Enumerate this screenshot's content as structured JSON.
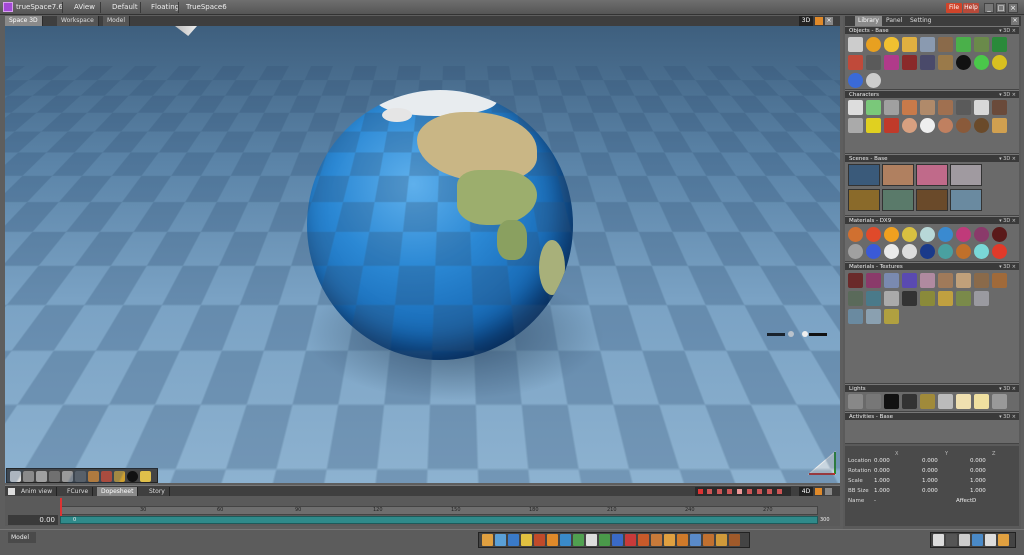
{
  "titlebar": {
    "app_title": "trueSpace7.6",
    "tabs": [
      "AView",
      "Default",
      "Floating",
      "TrueSpace6"
    ],
    "buttons": {
      "file": "File",
      "help": "Help"
    },
    "window_controls": [
      "_",
      "□",
      "×"
    ]
  },
  "viewport": {
    "tabs": [
      "Space 3D",
      "Workspace",
      "Model"
    ],
    "mode_badge": "3D"
  },
  "timeline": {
    "tabs": [
      "Anim view",
      "FCurve",
      "Dopesheet",
      "Story"
    ],
    "mode_badge": "4D",
    "current_time": "0.00",
    "start_frame": "0",
    "end_frame": "300",
    "ticks": [
      "30",
      "60",
      "90",
      "120",
      "150",
      "180",
      "210",
      "240",
      "270"
    ]
  },
  "statusbar": {
    "mode_label": "Model"
  },
  "right_panel": {
    "tabs": [
      "Library",
      "Panel",
      "Setting"
    ],
    "sections": [
      {
        "id": "objects",
        "title": "Objects - Base",
        "controls": "▾ 3D ×"
      },
      {
        "id": "characters",
        "title": "Characters",
        "controls": "▾ 3D ×"
      },
      {
        "id": "scenes",
        "title": "Scenes - Base",
        "controls": "▾ 3D ×"
      },
      {
        "id": "materials-dx9",
        "title": "Materials - DX9",
        "controls": "▾ 3D ×"
      },
      {
        "id": "materials-textures",
        "title": "Materials - Textures",
        "controls": "▾ 3D ×"
      },
      {
        "id": "lights",
        "title": "Lights",
        "controls": "▾ 3D ×"
      },
      {
        "id": "activities",
        "title": "Activities - Base",
        "controls": "▾ 3D ×"
      }
    ]
  },
  "properties": {
    "columns": [
      "X",
      "Y",
      "Z"
    ],
    "rows": [
      {
        "label": "Location",
        "values": [
          "0.000",
          "0.000",
          "0.000"
        ]
      },
      {
        "label": "Rotation",
        "values": [
          "0.000",
          "0.000",
          "0.000"
        ]
      },
      {
        "label": "Scale",
        "values": [
          "1.000",
          "1.000",
          "1.000"
        ]
      },
      {
        "label": "BB Size",
        "values": [
          "1.000",
          "0.000",
          "1.000"
        ]
      }
    ],
    "name_label": "Name",
    "name_value": "-",
    "affect_label": "Affect:",
    "affect_value": "D"
  },
  "colors": {
    "globe_ocean": "#2b88d4",
    "timeline_track": "#2f8a8a",
    "accent_orange": "#e08a2a"
  }
}
